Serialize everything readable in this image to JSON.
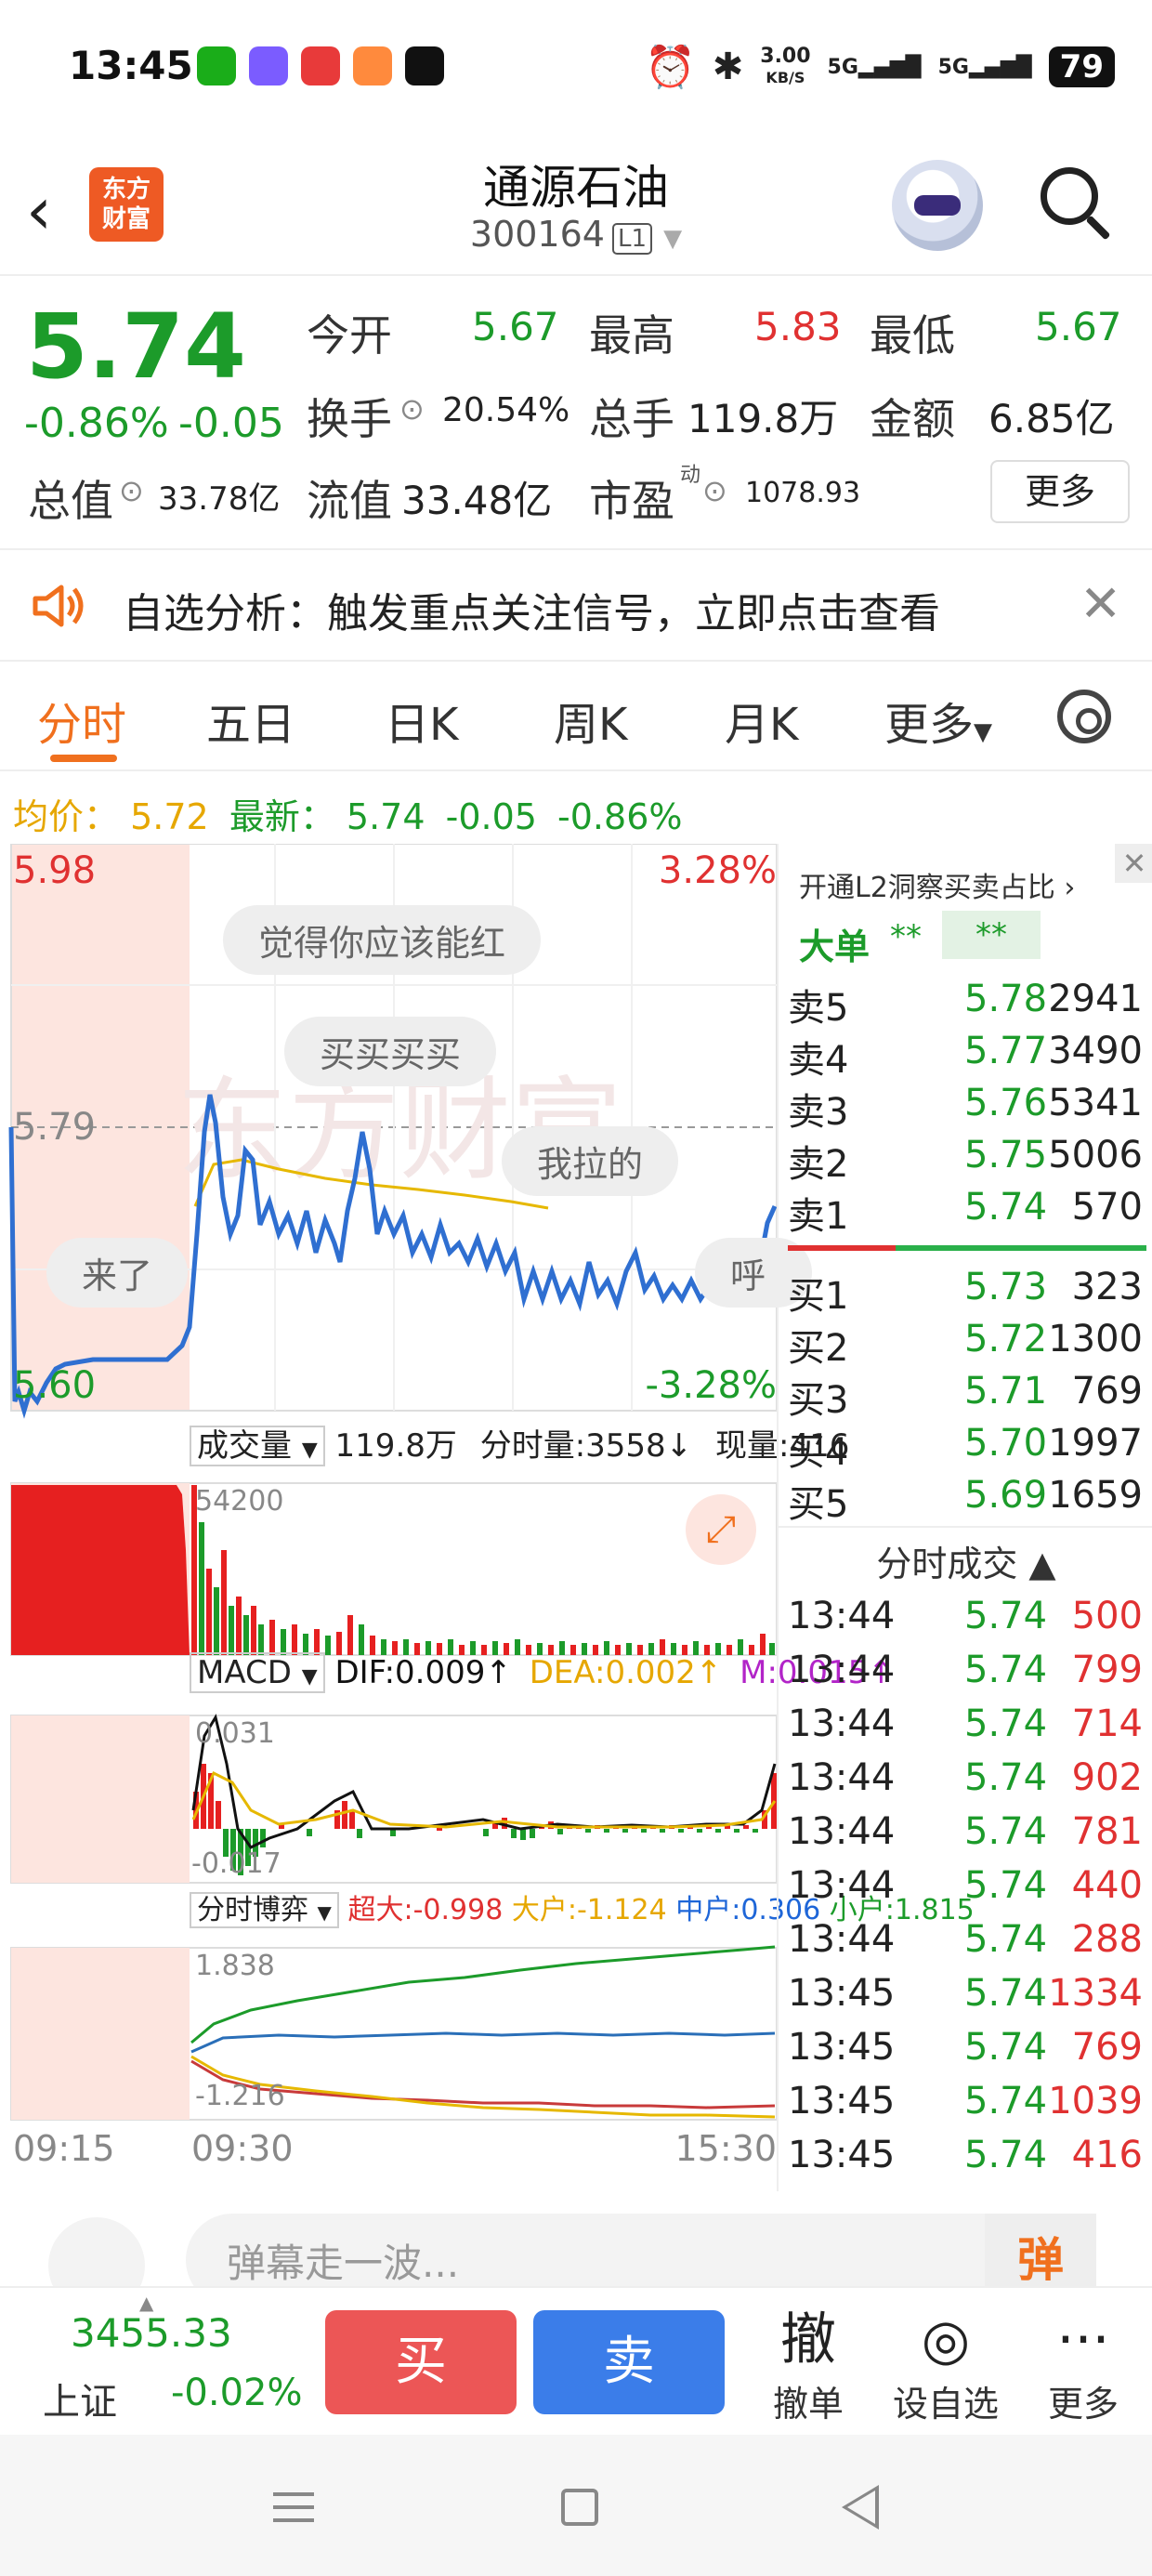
{
  "status_bar": {
    "time": "13:45",
    "net_speed": "3.00",
    "net_unit": "KB/S",
    "sig1": "5G",
    "sig2": "5G",
    "battery": "79"
  },
  "header": {
    "stock_name": "通源石油",
    "stock_code": "300164",
    "level": "L1",
    "logo_line1": "东方",
    "logo_line2": "财富"
  },
  "quote": {
    "price": "5.74",
    "change_pct": "-0.86%",
    "change": "-0.05",
    "open_label": "今开",
    "open": "5.67",
    "high_label": "最高",
    "high": "5.83",
    "low_label": "最低",
    "low": "5.67",
    "turnover_label": "换手",
    "turnover": "20.54%",
    "volume_label": "总手",
    "volume": "119.8万",
    "amount_label": "金额",
    "amount": "6.85亿",
    "mktcap_label": "总值",
    "mktcap": "33.78亿",
    "float_label": "流值",
    "float": "33.48亿",
    "pe_label": "市盈",
    "pe_sup": "动",
    "pe": "1078.93",
    "more": "更多"
  },
  "alert": {
    "text": "自选分析：触发重点关注信号，立即点击查看"
  },
  "tabs": [
    "分时",
    "五日",
    "日K",
    "周K",
    "月K",
    "更多"
  ],
  "avg": {
    "avg_label": "均价：",
    "avg_val": "5.72",
    "last_label": "最新：",
    "last_val": "5.74",
    "last_chg": "-0.05",
    "last_pct": "-0.86%"
  },
  "chart": {
    "y_high": "5.98",
    "y_mid": "5.79",
    "y_low": "5.60",
    "pct_high": "3.28%",
    "pct_low": "-3.28%",
    "watermark": "东方财富",
    "bubbles": [
      "觉得你应该能红",
      "买买买买",
      "我拉的",
      "来了",
      "呼"
    ],
    "vol_label": "成交量",
    "vol_total": "119.8万",
    "vol_tick": "分时量:3558↓",
    "vol_now": "现量:416",
    "vol_max": "54200",
    "macd_label": "MACD",
    "dif": "DIF:0.009↑",
    "dea": "DEA:0.002↑",
    "m": "M:0.015↑",
    "macd_hi": "0.031",
    "macd_lo": "-0.017",
    "flow_label": "分时博弈",
    "flow_super": "超大:-0.998",
    "flow_big": "大户:-1.124",
    "flow_mid": "中户:0.306",
    "flow_small": "小户:1.815",
    "flow_hi": "1.838",
    "flow_lo": "-1.216",
    "t_start": "09:15",
    "t_open": "09:30",
    "t_end": "15:30"
  },
  "book": {
    "header": "开通L2洞察买卖占比 ›",
    "big_label": "大单",
    "big_v1": "**",
    "big_v2": "**",
    "asks": [
      {
        "label": "卖5",
        "price": "5.78",
        "vol": "2941"
      },
      {
        "label": "卖4",
        "price": "5.77",
        "vol": "3490"
      },
      {
        "label": "卖3",
        "price": "5.76",
        "vol": "5341"
      },
      {
        "label": "卖2",
        "price": "5.75",
        "vol": "5006"
      },
      {
        "label": "卖1",
        "price": "5.74",
        "vol": "570"
      }
    ],
    "bids": [
      {
        "label": "买1",
        "price": "5.73",
        "vol": "323"
      },
      {
        "label": "买2",
        "price": "5.72",
        "vol": "1300"
      },
      {
        "label": "买3",
        "price": "5.71",
        "vol": "769"
      },
      {
        "label": "买4",
        "price": "5.70",
        "vol": "1997"
      },
      {
        "label": "买5",
        "price": "5.69",
        "vol": "1659"
      }
    ],
    "trades_title": "分时成交 ▲",
    "trades": [
      {
        "t": "13:44",
        "price": "5.74",
        "vol": "500"
      },
      {
        "t": "13:44",
        "price": "5.74",
        "vol": "799"
      },
      {
        "t": "13:44",
        "price": "5.74",
        "vol": "714"
      },
      {
        "t": "13:44",
        "price": "5.74",
        "vol": "902"
      },
      {
        "t": "13:44",
        "price": "5.74",
        "vol": "781"
      },
      {
        "t": "13:44",
        "price": "5.74",
        "vol": "440"
      },
      {
        "t": "13:44",
        "price": "5.74",
        "vol": "288"
      },
      {
        "t": "13:45",
        "price": "5.74",
        "vol": "1334"
      },
      {
        "t": "13:45",
        "price": "5.74",
        "vol": "769"
      },
      {
        "t": "13:45",
        "price": "5.74",
        "vol": "1039"
      },
      {
        "t": "13:45",
        "price": "5.74",
        "vol": "416"
      }
    ]
  },
  "comment": {
    "placeholder": "弹幕走一波...",
    "danmu": "弹"
  },
  "toolbar": {
    "index_value": "3455.33",
    "index_name": "上证",
    "index_change": "-0.02%",
    "buy": "买",
    "sell": "卖",
    "cancel_icon": "撤",
    "cancel": "撤单",
    "watch": "设自选",
    "more": "更多"
  },
  "colors": {
    "up": "#e03131",
    "down": "#1c9b2a",
    "accent": "#f0701e",
    "price_line": "#2f6fd1",
    "avg_line": "#e6b800"
  }
}
